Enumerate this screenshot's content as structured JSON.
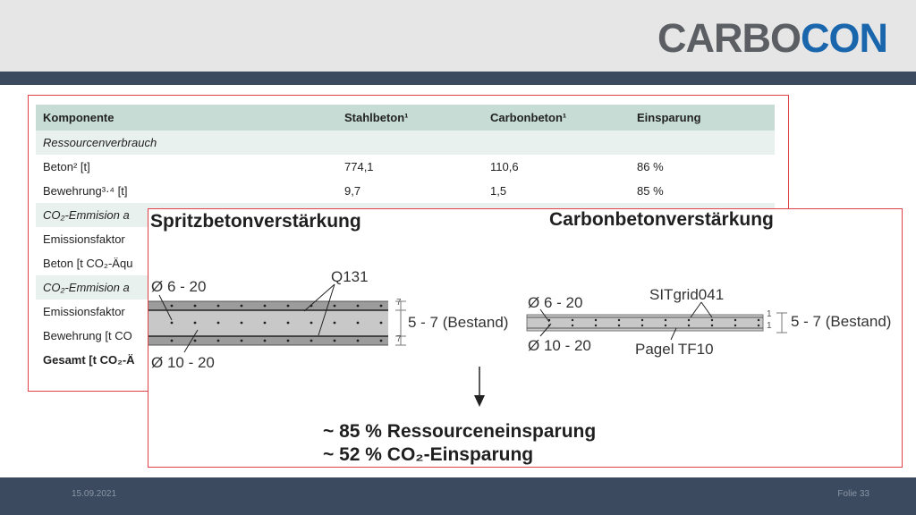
{
  "logo": {
    "part1": "CARBO",
    "part2": "CON"
  },
  "footer": {
    "date": "15.09.2021",
    "page": "Folie 33"
  },
  "table": {
    "headers": [
      "Komponente",
      "Stahlbeton¹",
      "Carbonbeton¹",
      "Einsparung"
    ],
    "rows": [
      {
        "type": "section",
        "cells": [
          "Ressourcenverbrauch",
          "",
          "",
          ""
        ]
      },
      {
        "type": "data",
        "cells": [
          "Beton² [t]",
          "774,1",
          "110,6",
          "86 %"
        ]
      },
      {
        "type": "data",
        "cells": [
          "Bewehrung³·⁴ [t]",
          "9,7",
          "1,5",
          "85 %"
        ]
      },
      {
        "type": "section",
        "cells": [
          "CO₂-Emmision a",
          "",
          "",
          ""
        ]
      },
      {
        "type": "data",
        "cells": [
          "Emissionsfaktor",
          "",
          "",
          ""
        ]
      },
      {
        "type": "data",
        "cells": [
          "Beton [t CO₂-Äqu",
          "",
          "",
          ""
        ]
      },
      {
        "type": "section",
        "cells": [
          "CO₂-Emmision a",
          "",
          "",
          ""
        ]
      },
      {
        "type": "data",
        "cells": [
          "Emissionsfaktor",
          "",
          "",
          ""
        ]
      },
      {
        "type": "data",
        "cells": [
          "Bewehrung [t CO",
          "",
          "",
          ""
        ]
      },
      {
        "type": "total",
        "cells": [
          "Gesamt [t CO₂-Ä",
          "",
          "",
          ""
        ]
      }
    ]
  },
  "overlay": {
    "left_title": "Spritzbetonverstärkung",
    "right_title": "Carbonbetonverstärkung",
    "left_d1": "Ø 6 - 20",
    "left_d2": "Ø 10 - 20",
    "left_mesh": "Q131",
    "left_thick": "5 - 7 (Bestand)",
    "left_dim_a": "7",
    "left_dim_b": "7",
    "right_d1": "Ø 6 - 20",
    "right_d2": "Ø 10 - 20",
    "right_grid": "SITgrid041",
    "right_pagel": "Pagel TF10",
    "right_thick": "5 - 7 (Bestand)",
    "right_dim_a": "1",
    "right_dim_b": "1",
    "result1": "~ 85 % Ressourceneinsparung",
    "result2": "~ 52 % CO₂-Einsparung"
  },
  "colors": {
    "header_bg": "#e6e6e6",
    "bar": "#3b4a5e",
    "accent": "#1a66ad",
    "logo_gray": "#5b5f63",
    "frame": "#e0404a",
    "table_head": "#c6dcd4",
    "table_section": "#e9f1ee"
  }
}
